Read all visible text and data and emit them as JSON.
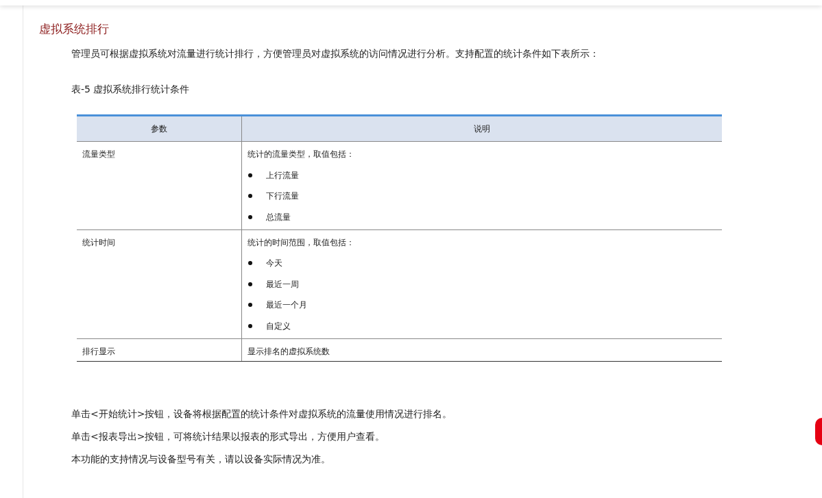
{
  "heading": "虚拟系统排行",
  "intro": "管理员可根据虚拟系统对流量进行统计排行，方便管理员对虚拟系统的访问情况进行分析。支持配置的统计条件如下表所示：",
  "table_caption": "表-5 虚拟系统排行统计条件",
  "table": {
    "columns": [
      "参数",
      "说明"
    ],
    "rows": [
      {
        "param": "流量类型",
        "description": "统计的流量类型，取值包括：",
        "options": [
          "上行流量",
          "下行流量",
          "总流量"
        ]
      },
      {
        "param": "统计时间",
        "description": "统计的时间范围，取值包括：",
        "options": [
          "今天",
          "最近一周",
          "最近一个月",
          "自定义"
        ]
      },
      {
        "param": "排行显示",
        "description": "显示排名的虚拟系统数"
      }
    ]
  },
  "notes": [
    "单击<开始统计>按钮，设备将根据配置的统计条件对虚拟系统的流量使用情况进行排名。",
    "单击<报表导出>按钮，可将统计结果以报表的形式导出，方便用户查看。",
    "本功能的支持情况与设备型号有关，请以设备实际情况为准。"
  ]
}
